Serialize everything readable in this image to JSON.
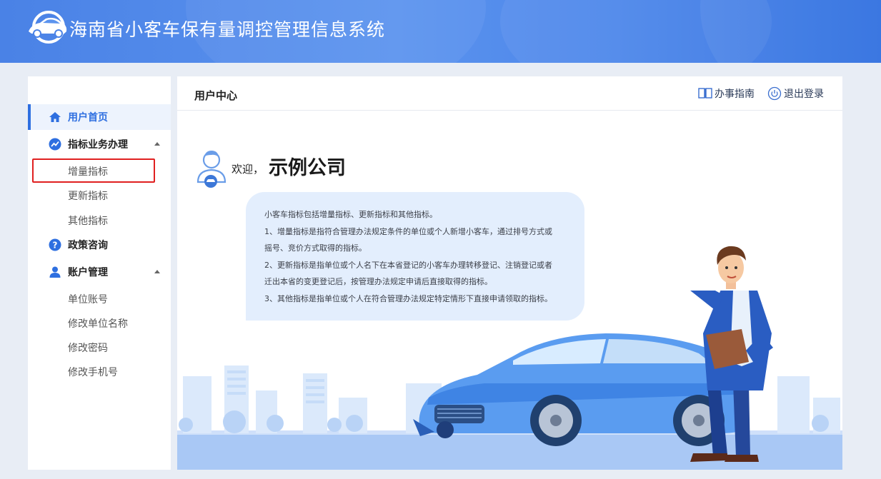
{
  "app": {
    "title": "海南省小客车保有量调控管理信息系统"
  },
  "sidebar": {
    "items": [
      {
        "label": "用户首页",
        "icon": "home-icon",
        "active": true
      },
      {
        "label": "指标业务办理",
        "icon": "trend-icon",
        "expanded": true,
        "children": [
          "增量指标",
          "更新指标",
          "其他指标"
        ]
      },
      {
        "label": "政策咨询",
        "icon": "question-icon"
      },
      {
        "label": "账户管理",
        "icon": "user-icon",
        "expanded": true,
        "children": [
          "单位账号",
          "修改单位名称",
          "修改密码",
          "修改手机号"
        ]
      }
    ]
  },
  "main": {
    "page_title": "用户中心",
    "guide_link": "办事指南",
    "logout_link": "退出登录",
    "welcome_label": "欢迎，",
    "company_name": "示例公司",
    "intro_lines": [
      "小客车指标包括增量指标、更新指标和其他指标。",
      "1、增量指标是指符合管理办法规定条件的单位或个人新增小客车，通过排号方式或",
      "摇号、竞价方式取得的指标。",
      "2、更新指标是指单位或个人名下在本省登记的小客车办理转移登记、注销登记或者",
      "迁出本省的变更登记后，按管理办法规定申请后直接取得的指标。",
      "3、其他指标是指单位或个人在符合管理办法规定特定情形下直接申请领取的指标。"
    ]
  },
  "colors": {
    "primary": "#2e6fe0",
    "header_gradient_start": "#4a82e6",
    "highlight_border": "#e02020",
    "bubble_bg": "#e3eefd"
  }
}
